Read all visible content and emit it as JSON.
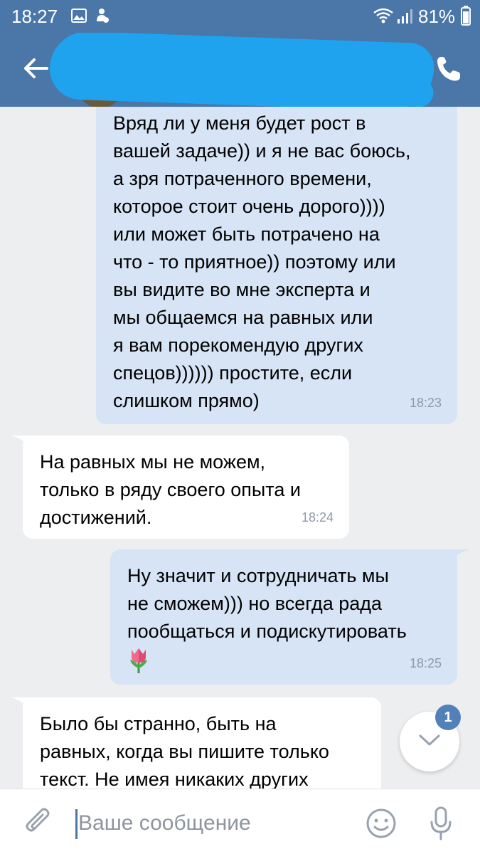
{
  "status_bar": {
    "time": "18:27",
    "battery": "81%",
    "icons": [
      "gallery-icon",
      "notification-icon",
      "wifi-icon",
      "signal-icon",
      "battery-icon"
    ]
  },
  "header": {
    "icons": [
      "back-arrow-icon",
      "phone-icon"
    ],
    "accent_color": "#4a76a8"
  },
  "messages": [
    {
      "direction": "outgoing",
      "text": "Вряд ли у меня будет рост в\nвашей задаче)) и я не вас боюсь,\nа зря потраченного времени,\nкоторое стоит очень дорого))))\nили может быть потрачено на\nчто - то приятное)) поэтому или\nвы видите во мне эксперта и\nмы общаемся на равных или\nя вам порекомендую других\nспецов)))))) простите, если\nслишком прямо)",
      "time": "18:23"
    },
    {
      "direction": "incoming",
      "text": "На равных мы не можем,\nтолько в ряду своего опыта и\nдостижений.",
      "time": "18:24"
    },
    {
      "direction": "outgoing",
      "text": "Ну значит и сотрудничать мы\nне сможем))) но всегда рада\nпообщаться и подискутировать",
      "emoji": "tulip-icon",
      "time": "18:25"
    },
    {
      "direction": "incoming",
      "text": "Было бы странно, быть на\nравных, когда вы пишите только\nтекст. Не имея никаких других"
    }
  ],
  "scroll_down": {
    "icon": "chevron-down-icon",
    "badge": "1"
  },
  "composer": {
    "placeholder": "Ваше сообщение",
    "icons": [
      "attach-icon",
      "emoji-icon",
      "microphone-icon"
    ]
  },
  "colors": {
    "outgoing_bubble": "#d6e4f5",
    "incoming_bubble": "#ffffff",
    "background": "#edeef0",
    "badge": "#5181b8"
  }
}
